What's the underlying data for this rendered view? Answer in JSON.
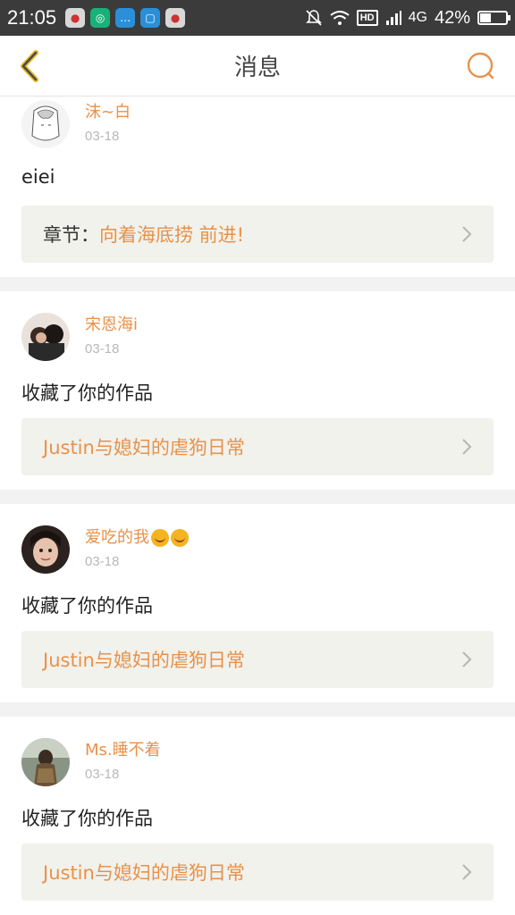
{
  "status_bar": {
    "time": "21:05",
    "network": "4G",
    "battery": "42%",
    "battery_level": 0.42,
    "hd_label": "HD",
    "apps": [
      "chicken-app-icon",
      "circle-app-icon",
      "message-app-icon",
      "scan-app-icon",
      "chicken-app-icon"
    ]
  },
  "header": {
    "title": "消息",
    "back_icon": "chevron-left-icon",
    "search_icon": "search-icon",
    "accent": "#e8914a"
  },
  "messages": [
    {
      "username": "沫~白",
      "date": "03-18",
      "text": "eiei",
      "link_label": "章节：",
      "link_value": "向着海底捞 前进!"
    },
    {
      "username": "宋恩海i",
      "date": "03-18",
      "text": "收藏了你的作品",
      "link_label": "",
      "link_value": "Justin与媳妇的虐狗日常"
    },
    {
      "username": "爱吃的我",
      "date": "03-18",
      "text": "收藏了你的作品",
      "link_label": "",
      "link_value": "Justin与媳妇的虐狗日常"
    },
    {
      "username": "Ms.睡不着",
      "date": "03-18",
      "text": "收藏了你的作品",
      "link_label": "",
      "link_value": "Justin与媳妇的虐狗日常"
    }
  ]
}
